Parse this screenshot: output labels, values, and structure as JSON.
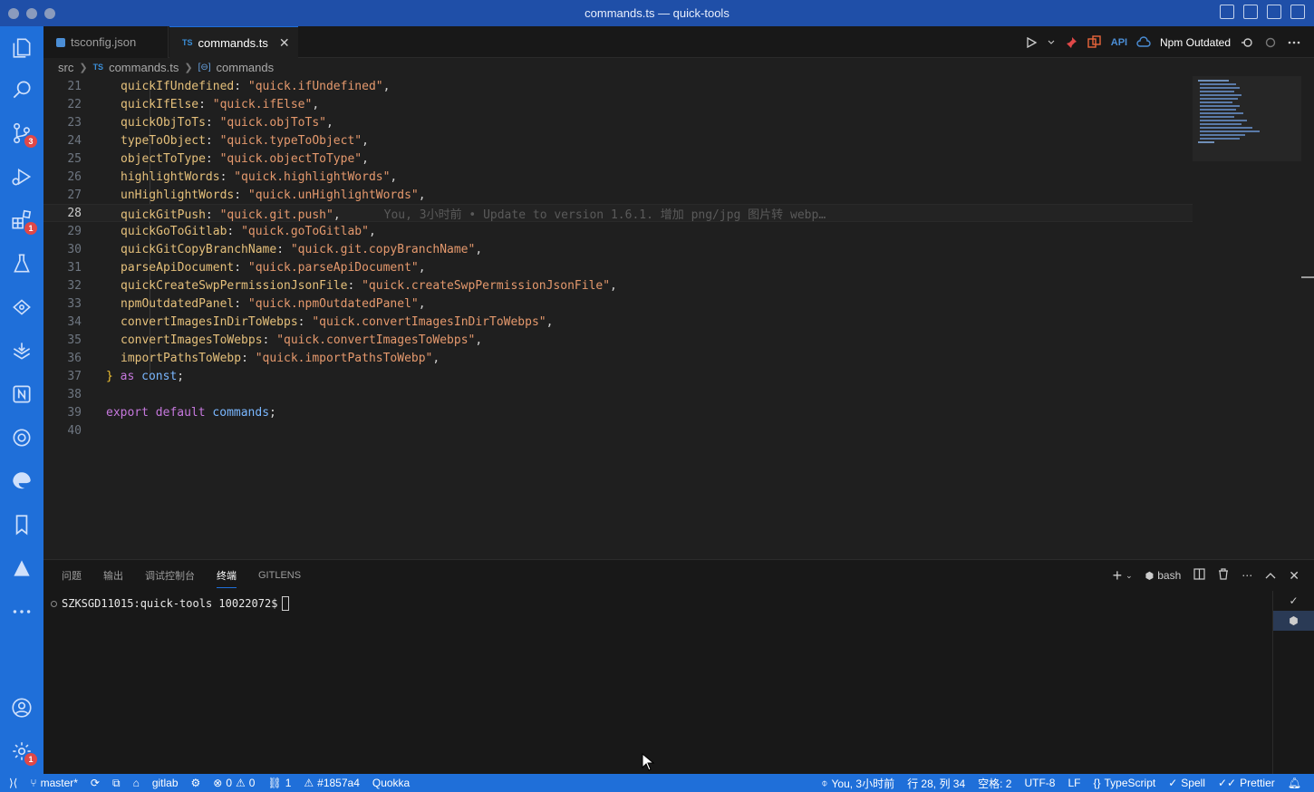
{
  "window": {
    "title": "commands.ts — quick-tools"
  },
  "activity": {
    "badges": {
      "scm": "3",
      "extensions": "1",
      "settings": "1"
    },
    "accent": "#1f6fd9"
  },
  "tabs": [
    {
      "label": "tsconfig.json",
      "icon": "json-icon"
    },
    {
      "label": "commands.ts",
      "icon_text": "TS",
      "close": "✕"
    }
  ],
  "editor_actions": {
    "npm_label": "Npm Outdated"
  },
  "breadcrumb": {
    "folder": "src",
    "file_icon": "TS",
    "file": "commands.ts",
    "symbol": "commands"
  },
  "code": [
    {
      "n": "21",
      "key": "quickIfUndefined",
      "val": "\"quick.ifUndefined\""
    },
    {
      "n": "22",
      "key": "quickIfElse",
      "val": "\"quick.ifElse\""
    },
    {
      "n": "23",
      "key": "quickObjToTs",
      "val": "\"quick.objToTs\""
    },
    {
      "n": "24",
      "key": "typeToObject",
      "val": "\"quick.typeToObject\""
    },
    {
      "n": "25",
      "key": "objectToType",
      "val": "\"quick.objectToType\""
    },
    {
      "n": "26",
      "key": "highlightWords",
      "val": "\"quick.highlightWords\""
    },
    {
      "n": "27",
      "key": "unHighlightWords",
      "val": "\"quick.unHighlightWords\""
    },
    {
      "n": "28",
      "key": "quickGitPush",
      "val": "\"quick.git.push\"",
      "blame": "You, 3小时前 • Update to version 1.6.1. 增加 png/jpg 图片转 webp…"
    },
    {
      "n": "29",
      "key": "quickGoToGitlab",
      "val": "\"quick.goToGitlab\""
    },
    {
      "n": "30",
      "key": "quickGitCopyBranchName",
      "val": "\"quick.git.copyBranchName\""
    },
    {
      "n": "31",
      "key": "parseApiDocument",
      "val": "\"quick.parseApiDocument\""
    },
    {
      "n": "32",
      "key": "quickCreateSwpPermissionJsonFile",
      "val": "\"quick.createSwpPermissionJsonFile\""
    },
    {
      "n": "33",
      "key": "npmOutdatedPanel",
      "val": "\"quick.npmOutdatedPanel\""
    },
    {
      "n": "34",
      "key": "convertImagesInDirToWebps",
      "val": "\"quick.convertImagesInDirToWebps\""
    },
    {
      "n": "35",
      "key": "convertImagesToWebps",
      "val": "\"quick.convertImagesToWebps\""
    },
    {
      "n": "36",
      "key": "importPathsToWebp",
      "val": "\"quick.importPathsToWebp\""
    }
  ],
  "code_tail": {
    "l37": {
      "n": "37",
      "brace": "}",
      "as": "as",
      "const": "const",
      "semi": ";"
    },
    "l38": {
      "n": "38"
    },
    "l39": {
      "n": "39",
      "export": "export",
      "default": "default",
      "ident": "commands",
      "semi": ";"
    },
    "l40": {
      "n": "40"
    }
  },
  "panel": {
    "tabs": [
      "问题",
      "输出",
      "调试控制台",
      "终端",
      "GITLENS"
    ],
    "active_tab": "终端",
    "shell": "bash",
    "prompt": "SZKSGD11015:quick-tools 10022072$"
  },
  "status": {
    "branch": "master*",
    "gitlab": "gitlab",
    "errors": "0",
    "warnings": "0",
    "ports": "1",
    "commit": "#1857a4",
    "quokka": "Quokka",
    "blame": "You, 3小时前",
    "position": "行 28, 列 34",
    "spaces": "空格: 2",
    "encoding": "UTF-8",
    "eol": "LF",
    "language": "TypeScript",
    "spell": "Spell",
    "prettier": "Prettier"
  }
}
